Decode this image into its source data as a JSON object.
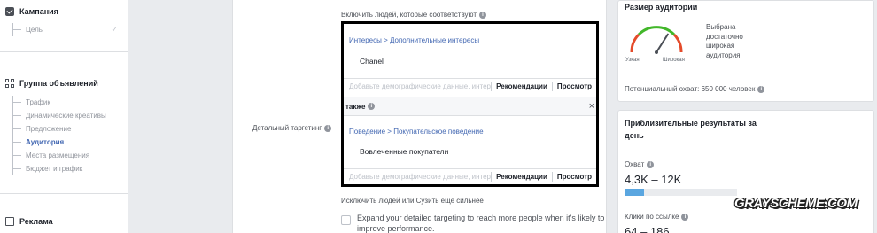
{
  "nav": {
    "campaign": {
      "label": "Кампания",
      "items": [
        {
          "label": "Цель",
          "check": "✓"
        }
      ]
    },
    "adset": {
      "label": "Группа объявлений",
      "items": [
        {
          "label": "Трафик"
        },
        {
          "label": "Динамические креативы"
        },
        {
          "label": "Предложение"
        },
        {
          "label": "Аудитория"
        },
        {
          "label": "Места размещения"
        },
        {
          "label": "Бюджет и график"
        }
      ]
    },
    "ad": {
      "label": "Реклама"
    }
  },
  "targeting": {
    "field_label": "Детальный таргетинг",
    "include_title": "Включить людей, которые соответствуют",
    "group1": {
      "path": "Интересы > Дополнительные интересы",
      "value": "Chanel"
    },
    "group2": {
      "path": "Поведение > Покупательское поведение",
      "value": "Вовлеченные покупатели"
    },
    "input_placeholder": "Добавьте демографические данные, интересы или",
    "recommend_button": "Рекомендации",
    "browse_button": "Просмотр",
    "also_label": "также",
    "close_symbol": "×",
    "exclude_link": "Исключить людей или Сузить еще сильнее",
    "expand_text": "Expand your detailed targeting to reach more people when it's likely to improve performance."
  },
  "audience": {
    "title": "Размер аудитории",
    "gauge_low": "Узкая",
    "gauge_high": "Широкая",
    "gauge_level": 0.68,
    "description": "Выбрана достаточно широкая аудитория.",
    "potential": "Потенциальный охват: 650 000 человек"
  },
  "results": {
    "title": "Приблизительные результаты за день",
    "reach_label": "Охват",
    "reach_value": "4,3K – 12K",
    "reach_bar_fraction": 0.17,
    "clicks_label": "Клики по ссылке",
    "clicks_value": "64 – 186"
  },
  "watermark": "GRAYSCHEME.COM",
  "colors": {
    "accent": "#4267b2",
    "bar": "#5aa6e0",
    "gauge_green": "#42b72a",
    "gauge_red": "#e44b2b"
  }
}
